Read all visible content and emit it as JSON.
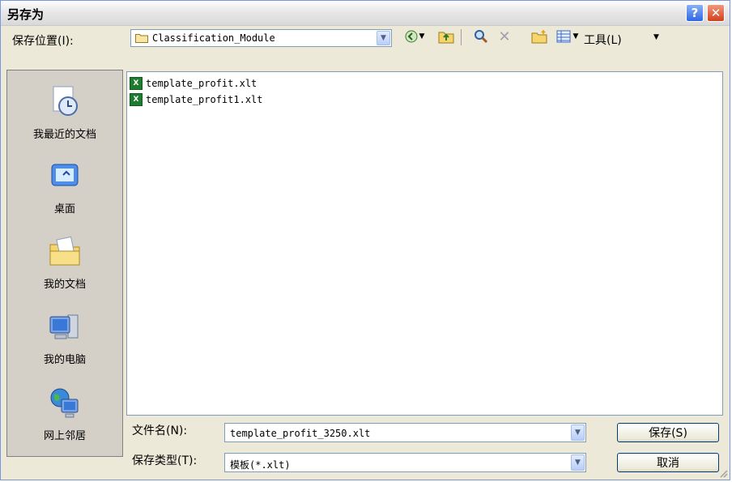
{
  "window": {
    "title": "另存为",
    "help_label": "?",
    "close_label": "✕"
  },
  "location": {
    "label": "保存位置(I):",
    "value": "Classification_Module"
  },
  "toolbar": {
    "icons": [
      "back-icon",
      "up-folder-icon",
      "search-web-icon",
      "delete-icon",
      "new-folder-icon",
      "views-icon"
    ],
    "tools_label": "工具(L)"
  },
  "places": [
    {
      "label": "我最近的文档",
      "icon": "recent-documents-icon"
    },
    {
      "label": "桌面",
      "icon": "desktop-icon"
    },
    {
      "label": "我的文档",
      "icon": "my-documents-icon"
    },
    {
      "label": "我的电脑",
      "icon": "my-computer-icon"
    },
    {
      "label": "网上邻居",
      "icon": "network-places-icon"
    }
  ],
  "files": [
    {
      "name": "template_profit.xlt",
      "icon": "excel-file-icon"
    },
    {
      "name": "template_profit1.xlt",
      "icon": "excel-file-icon"
    }
  ],
  "filename": {
    "label": "文件名(N):",
    "value": "template_profit_3250.xlt"
  },
  "filetype": {
    "label": "保存类型(T):",
    "value": "模板(*.xlt)"
  },
  "buttons": {
    "save": "保存(S)",
    "cancel": "取消"
  }
}
